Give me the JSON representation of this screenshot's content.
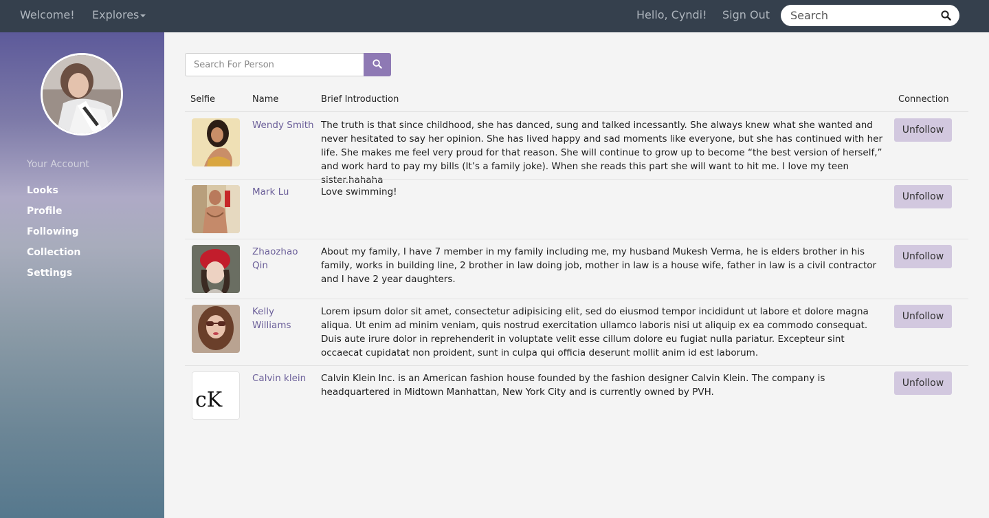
{
  "navbar": {
    "welcome": "Welcome!",
    "explores": "Explores",
    "greeting": "Hello, Cyndi!",
    "sign_out": "Sign Out",
    "search_placeholder": "Search"
  },
  "sidebar": {
    "heading": "Your Account",
    "items": [
      {
        "label": "Looks"
      },
      {
        "label": "Profile"
      },
      {
        "label": "Following"
      },
      {
        "label": "Collection"
      },
      {
        "label": "Settings"
      }
    ]
  },
  "person_search": {
    "placeholder": "Search For Person"
  },
  "table": {
    "headers": {
      "selfie": "Selfie",
      "name": "Name",
      "intro": "Brief Introduction",
      "connection": "Connection"
    },
    "rows": [
      {
        "name": "Wendy Smith",
        "intro": "The truth is that since childhood, she has danced, sung and talked incessantly. She always knew what she wanted and never hesitated to say her opinion. She has lived happy and sad moments like everyone, but she has continued with her life. She makes me feel very proud for that reason. She will continue to grow up to become “the best version of herself,” and work hard to pay my bills (It’s a family joke). When she reads this part she will want to hit me. I love my teen sister.hahaha",
        "button": "Unfollow"
      },
      {
        "name": "Mark Lu",
        "intro": "Love swimming!",
        "button": "Unfollow"
      },
      {
        "name": "Zhaozhao Qin",
        "intro": "About my family, I have 7 member in my family including me, my husband Mukesh Verma, he is elders brother in his family, works in building line, 2 brother in law doing job, mother in law is a house wife, father in law is a civil contractor and I have 2 year daughters.",
        "button": "Unfollow"
      },
      {
        "name": "Kelly Williams",
        "intro": "Lorem ipsum dolor sit amet, consectetur adipisicing elit, sed do eiusmod tempor incididunt ut labore et dolore magna aliqua. Ut enim ad minim veniam, quis nostrud exercitation ullamco laboris nisi ut aliquip ex ea commodo consequat. Duis aute irure dolor in reprehenderit in voluptate velit esse cillum dolore eu fugiat nulla pariatur. Excepteur sint occaecat cupidatat non proident, sunt in culpa qui officia deserunt mollit anim id est laborum.",
        "button": "Unfollow"
      },
      {
        "name": "Calvin klein",
        "intro": "Calvin Klein Inc. is an American fashion house founded by the fashion designer Calvin Klein. The company is headquartered in Midtown Manhattan, New York City and is currently owned by PVH.",
        "button": "Unfollow",
        "logo_text": "cK"
      }
    ]
  },
  "colors": {
    "navbar": "#35404d",
    "accent": "#8e79b4",
    "unfollow_button": "#d2c8df",
    "name_link": "#6b5f99"
  }
}
